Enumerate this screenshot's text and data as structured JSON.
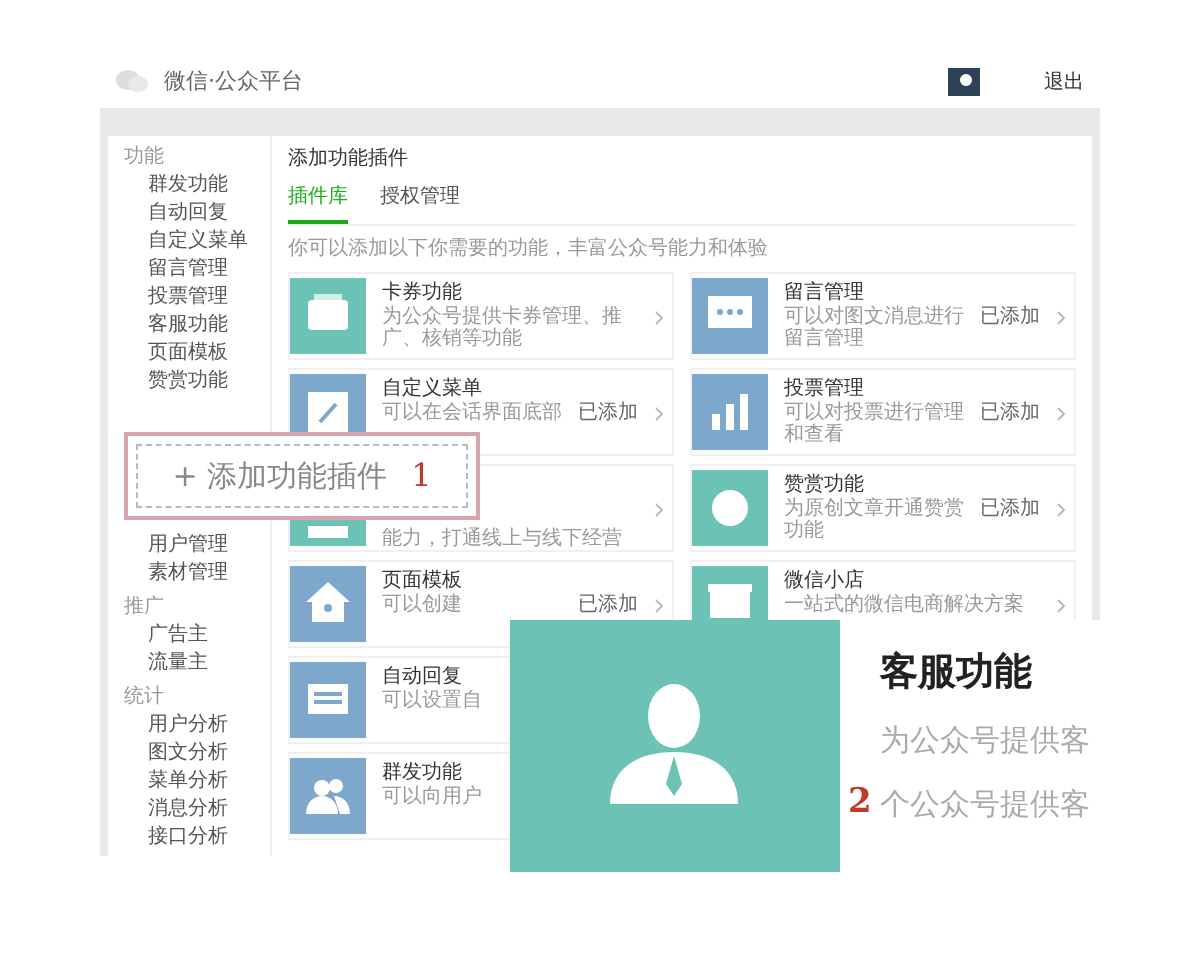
{
  "header": {
    "title": "微信·公众平台",
    "logout": "退出"
  },
  "sidebar": {
    "sections": [
      {
        "title": "功能",
        "items": [
          "群发功能",
          "自动回复",
          "自定义菜单",
          "留言管理",
          "投票管理",
          "客服功能",
          "页面模板",
          "赞赏功能"
        ]
      },
      {
        "items": [
          "用户管理",
          "素材管理"
        ]
      },
      {
        "title": "推广",
        "items": [
          "广告主",
          "流量主"
        ]
      },
      {
        "title": "统计",
        "items": [
          "用户分析",
          "图文分析",
          "菜单分析",
          "消息分析",
          "接口分析"
        ]
      }
    ]
  },
  "main": {
    "title": "添加功能插件",
    "tabs": [
      {
        "label": "插件库",
        "selected": true
      },
      {
        "label": "授权管理",
        "selected": false
      }
    ],
    "description": "你可以添加以下你需要的功能，丰富公众号能力和体验",
    "left_column": [
      {
        "title": "卡券功能",
        "text": "为公众号提供卡券管理、推广、核销等功能",
        "color": "#6cc3b5"
      },
      {
        "title": "自定义菜单",
        "text": "可以在会话界面底部",
        "status": "已添加",
        "color": "#7ea7cc"
      },
      {
        "text": "能力，打通线上与线下经营",
        "color": "#6cc3b5"
      },
      {
        "title": "页面模板",
        "text": "可以创建",
        "status": "已添加",
        "color": "#7ea7cc"
      },
      {
        "title": "自动回复",
        "text": "可以设置自",
        "color": "#7ea7cc"
      },
      {
        "title": "群发功能",
        "text": "可以向用户",
        "color": "#7ea7cc"
      }
    ],
    "right_column": [
      {
        "title": "留言管理",
        "text": "可以对图文消息进行留言管理",
        "status": "已添加",
        "color": "#7ea7cc"
      },
      {
        "title": "投票管理",
        "text": "可以对投票进行管理和查看",
        "status": "已添加",
        "color": "#7ea7cc"
      },
      {
        "title": "赞赏功能",
        "text": "为原创文章开通赞赏功能",
        "status": "已添加",
        "color": "#6cc3b5"
      },
      {
        "title": "微信小店",
        "text": "一站式的微信电商解决方案",
        "color": "#6cc3b5"
      }
    ]
  },
  "callout_1": {
    "label": "+ 添加功能插件",
    "number": "1"
  },
  "callout_2": {
    "title": "客服功能",
    "line_1": "为公众号提供客",
    "number": "2",
    "line_2": "个公众号提供客"
  }
}
